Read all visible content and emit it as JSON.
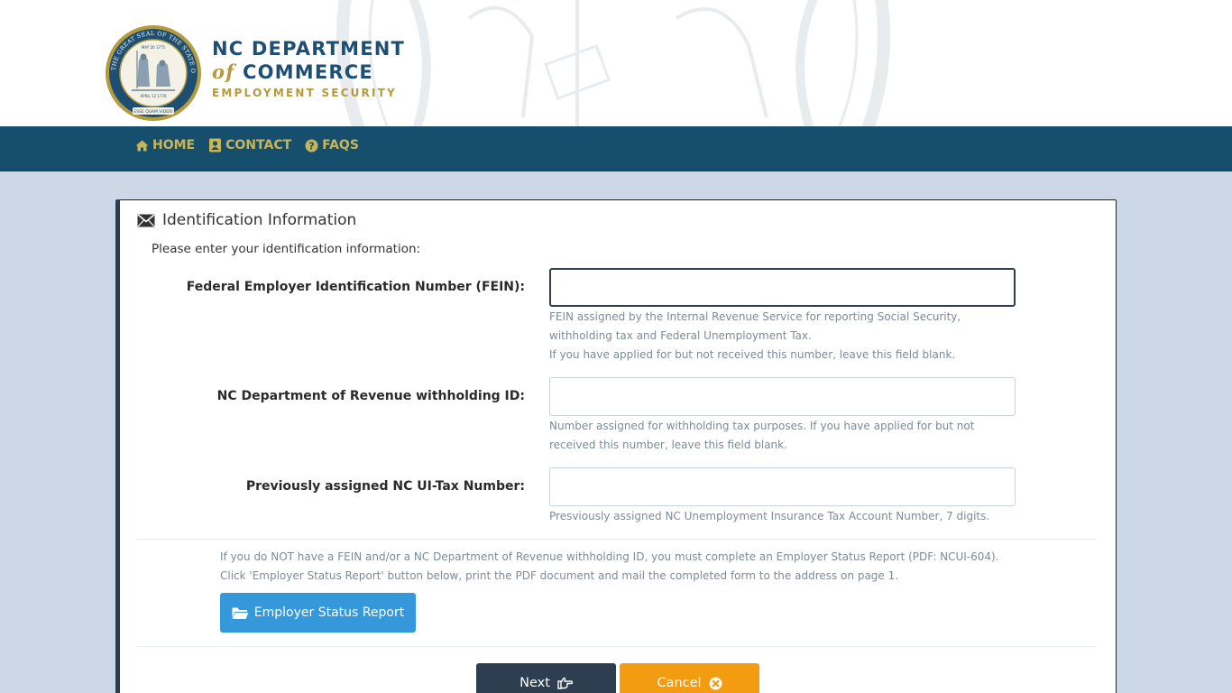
{
  "header": {
    "seal_alt": "The Great Seal of the State of North Carolina",
    "seal_text_top": "THE GREAT SEAL OF THE STATE OF NORTH CAROLINA",
    "seal_date": "MAY 20 1775",
    "seal_date2": "APRIL 12 1776",
    "seal_motto": "ESSE QUAM VIDERI",
    "brand_line1": "NC DEPARTMENT",
    "brand_of": "of",
    "brand_line2": " COMMERCE",
    "brand_line3": "EMPLOYMENT SECURITY"
  },
  "nav": {
    "items": [
      {
        "label": "HOME",
        "icon": "home-icon"
      },
      {
        "label": "CONTACT",
        "icon": "contact-icon"
      },
      {
        "label": "FAQS",
        "icon": "question-circle-icon"
      }
    ]
  },
  "panel": {
    "title": "Identification Information",
    "intro": "Please enter your identification information:"
  },
  "fields": {
    "fein": {
      "label": "Federal Employer Identification Number (FEIN):",
      "value": "",
      "help1": "FEIN assigned by the Internal Revenue Service for reporting Social Security, withholding tax and Federal Unemployment Tax.",
      "help2": "If you have applied for but not received this number, leave this field blank."
    },
    "dor": {
      "label": "NC Department of Revenue withholding ID:",
      "value": "",
      "help1": "Number assigned for withholding tax purposes. If you have applied for but not received this number, leave this field blank."
    },
    "uitax": {
      "label": "Previously assigned NC UI-Tax Number:",
      "value": "",
      "help1": "Presviously assigned NC Unemployment Insurance Tax Account Number, 7 digits."
    }
  },
  "note": {
    "line1": "If you do NOT have a FEIN and/or a NC Department of Revenue withholding ID, you must complete an Employer Status Report (PDF: NCUI-604).",
    "line2": "Click 'Employer Status Report' button below, print the PDF document and mail the completed form to the address on page 1."
  },
  "buttons": {
    "report": "Employer Status Report",
    "next": "Next",
    "cancel": "Cancel"
  },
  "colors": {
    "nav_bg": "#164e6e",
    "nav_text": "#c9b554",
    "page_bg": "#ccd8e6",
    "report_btn": "#3498db",
    "next_btn": "#2c3e50",
    "cancel_btn": "#f39c12"
  }
}
